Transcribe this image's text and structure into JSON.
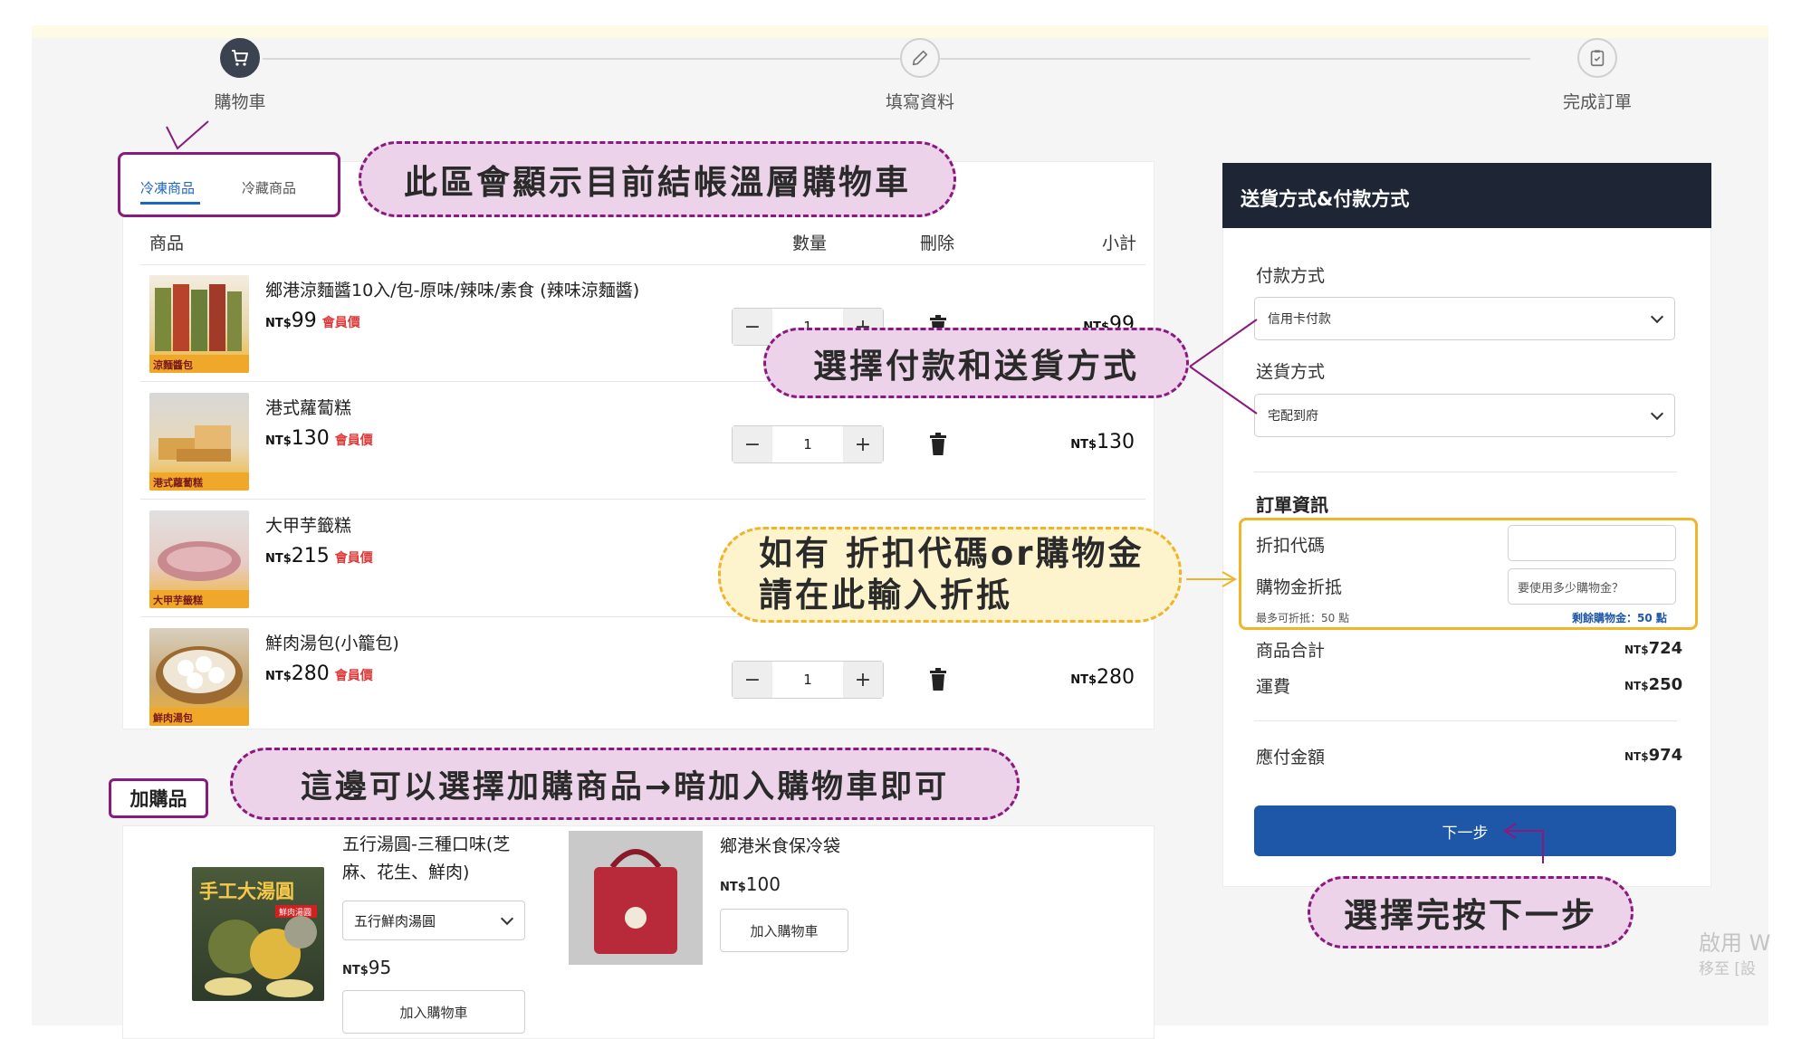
{
  "steps": [
    {
      "label": "購物車"
    },
    {
      "label": "填寫資料"
    },
    {
      "label": "完成訂單"
    }
  ],
  "tabs": {
    "frozen": "冷凍商品",
    "chilled": "冷藏商品"
  },
  "columns": {
    "product": "商品",
    "qty": "數量",
    "delete": "刪除",
    "subtotal": "小計"
  },
  "currency": "NT$",
  "member_price_label": "會員價",
  "items": [
    {
      "name": "鄉港涼麵醬10入/包-原味/辣味/素食 (辣味涼麵醬)",
      "price": "99",
      "qty": "1",
      "subtotal": "99",
      "thumb_caption": "涼麵醬包"
    },
    {
      "name": "港式蘿蔔糕",
      "price": "130",
      "qty": "1",
      "subtotal": "130",
      "thumb_caption": "港式蘿蔔糕"
    },
    {
      "name": "大甲芋籤糕",
      "price": "215",
      "qty": "",
      "subtotal": "",
      "thumb_caption": "大甲芋籤糕"
    },
    {
      "name": "鮮肉湯包(小籠包)",
      "price": "280",
      "qty": "1",
      "subtotal": "280",
      "thumb_caption": "鮮肉湯包"
    }
  ],
  "addons": {
    "label": "加購品",
    "items": [
      {
        "name_line1": "五行湯圓-三種口味(芝",
        "name_line2": "麻、花生、鮮肉)",
        "option": "五行鮮肉湯圓",
        "price": "95",
        "button": "加入購物車",
        "thumb_title": "手工大湯圓",
        "thumb_badge": "鮮肉湯圓"
      },
      {
        "name": "鄉港米食保冷袋",
        "price": "100",
        "button": "加入購物車"
      }
    ]
  },
  "side": {
    "header": "送貨方式&付款方式",
    "payment_label": "付款方式",
    "payment_value": "信用卡付款",
    "shipping_label": "送貨方式",
    "shipping_value": "宅配到府",
    "order_info_title": "訂單資訊",
    "coupon_label": "折扣代碼",
    "coupon_value": "",
    "credit_label": "購物金折抵",
    "credit_placeholder": "要使用多少購物金？",
    "max_discount": "最多可折抵：50 點",
    "remaining_credit": "剩餘購物金：50 點",
    "items_total_label": "商品合計",
    "items_total": "724",
    "shipping_fee_label": "運費",
    "shipping_fee": "250",
    "grand_total_label": "應付金額",
    "grand_total": "974",
    "next_button": "下一步"
  },
  "callouts": {
    "cart_tabs": "此區會顯示目前結帳溫層購物車",
    "payment_shipping": "選擇付款和送貨方式",
    "discount_line1": "如有  折扣代碼or購物金",
    "discount_line2": "請在此輸入折抵",
    "addons": "這邊可以選擇加購商品→暗加入購物車即可",
    "next_step": "選擇完按下一步"
  },
  "watermark": {
    "line1": "啟用 W",
    "line2": "移至 [設"
  },
  "colors": {
    "accent_blue": "#1e56a8",
    "header_dark": "#1e2635",
    "member_red": "#e03a3a",
    "callout_purple": "#8a1a7e",
    "callout_yellow": "#efb42a"
  }
}
